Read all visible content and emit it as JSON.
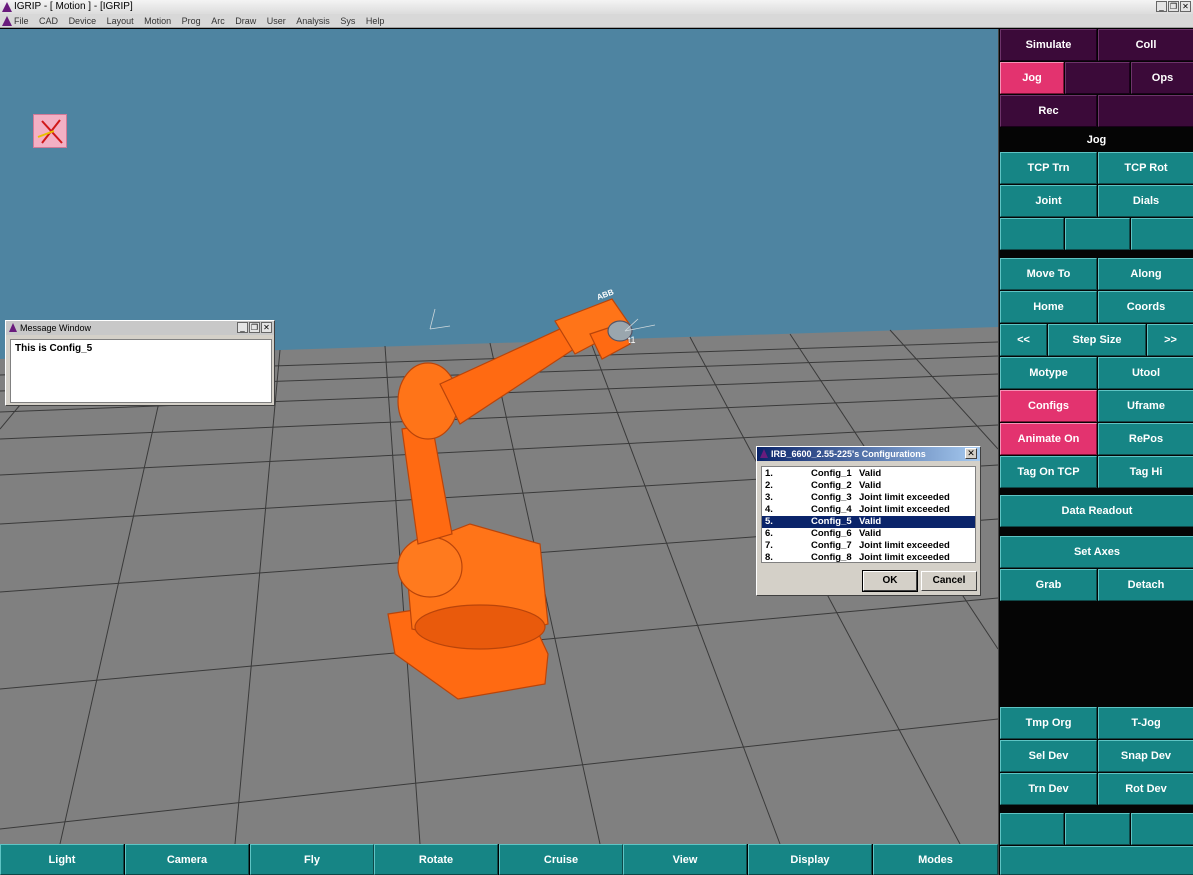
{
  "window": {
    "title": "IGRIP - [ Motion ] - [IGRIP]",
    "controls": [
      "_",
      "❐",
      "✕"
    ]
  },
  "menu": [
    "File",
    "CAD",
    "Device",
    "Layout",
    "Motion",
    "Prog",
    "Arc",
    "Draw",
    "User",
    "Analysis",
    "Sys",
    "Help"
  ],
  "viewport": {
    "sky_color": "#4e84a1",
    "floor_color": "#808080",
    "robot_color": "#ff6a12",
    "robot_brand": "ABB",
    "tool_frame_label": "t1"
  },
  "message_window": {
    "title": "Message Window",
    "text": "This is Config_5"
  },
  "config_dialog": {
    "title": "IRB_6600_2.55-225's Configurations",
    "rows": [
      {
        "num": "1.",
        "name": "Config_1",
        "status": "Valid",
        "selected": false
      },
      {
        "num": "2.",
        "name": "Config_2",
        "status": "Valid",
        "selected": false
      },
      {
        "num": "3.",
        "name": "Config_3",
        "status": "Joint limit exceeded",
        "selected": false
      },
      {
        "num": "4.",
        "name": "Config_4",
        "status": "Joint limit exceeded",
        "selected": false
      },
      {
        "num": "5.",
        "name": "Config_5",
        "status": "Valid",
        "selected": true
      },
      {
        "num": "6.",
        "name": "Config_6",
        "status": "Valid",
        "selected": false
      },
      {
        "num": "7.",
        "name": "Config_7",
        "status": "Joint limit exceeded",
        "selected": false
      },
      {
        "num": "8.",
        "name": "Config_8",
        "status": "Joint limit exceeded",
        "selected": false
      }
    ],
    "ok_label": "OK",
    "cancel_label": "Cancel",
    "selected_color": "#0a246a"
  },
  "right_panel": {
    "simulate": "Simulate",
    "coll": "Coll",
    "jog": "Jog",
    "ops": "Ops",
    "rec": "Rec",
    "jog_header": "Jog",
    "tcp_trn": "TCP Trn",
    "tcp_rot": "TCP Rot",
    "joint": "Joint",
    "dials": "Dials",
    "move_to": "Move To",
    "along": "Along",
    "home": "Home",
    "coords": "Coords",
    "step_prev": "<<",
    "step_size": "Step Size",
    "step_next": ">>",
    "motype": "Motype",
    "utool": "Utool",
    "configs": "Configs",
    "uframe": "Uframe",
    "animate_on": "Animate On",
    "repos": "RePos",
    "tag_on_tcp": "Tag On TCP",
    "tag_hi": "Tag Hi",
    "data_readout": "Data Readout",
    "set_axes": "Set Axes",
    "grab": "Grab",
    "detach": "Detach",
    "tmp_org": "Tmp Org",
    "t_jog": "T-Jog",
    "sel_dev": "Sel Dev",
    "snap_dev": "Snap Dev",
    "trn_dev": "Trn Dev",
    "rot_dev": "Rot Dev",
    "colors": {
      "teal": "#168585",
      "pink": "#e3336f",
      "purple": "#3b0a39"
    }
  },
  "bottom_bar": [
    "Light",
    "Camera",
    "Fly",
    "Rotate",
    "Cruise",
    "View",
    "Display",
    "Modes"
  ]
}
